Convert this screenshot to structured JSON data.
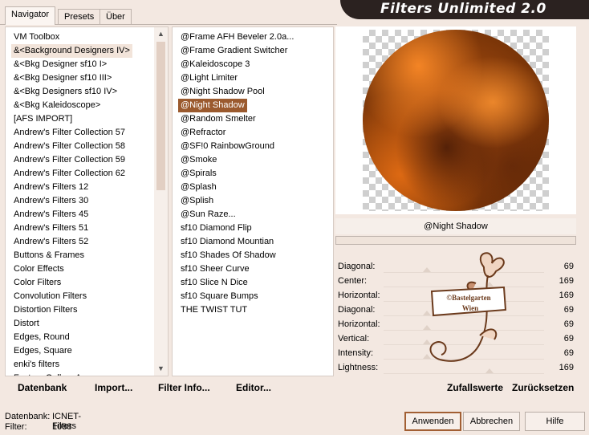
{
  "tabs": [
    {
      "label": "Navigator",
      "active": true
    },
    {
      "label": "Presets",
      "active": false
    },
    {
      "label": "Über",
      "active": false
    }
  ],
  "banner": {
    "title": "Filters Unlimited 2.0"
  },
  "categories": [
    "VM Toolbox",
    "&<Background Designers IV>",
    "&<Bkg Designer sf10 I>",
    "&<Bkg Designer sf10 III>",
    "&<Bkg Designers sf10 IV>",
    "&<Bkg Kaleidoscope>",
    "[AFS IMPORT]",
    "Andrew's Filter Collection 57",
    "Andrew's Filter Collection 58",
    "Andrew's Filter Collection 59",
    "Andrew's Filter Collection 62",
    "Andrew's Filters 12",
    "Andrew's Filters 30",
    "Andrew's Filters 45",
    "Andrew's Filters 51",
    "Andrew's Filters 52",
    "Buttons & Frames",
    "Color Effects",
    "Color Filters",
    "Convolution Filters",
    "Distortion Filters",
    "Distort",
    "Edges, Round",
    "Edges, Square",
    "enki's filters",
    "Factory Gallery A"
  ],
  "category_highlight_index": 1,
  "filters": [
    "@Frame AFH Beveler 2.0a...",
    "@Frame Gradient Switcher",
    "@Kaleidoscope 3",
    "@Light Limiter",
    "@Night Shadow Pool",
    "@Night Shadow",
    "@Random Smelter",
    "@Refractor",
    "@SF!0 RainbowGround",
    "@Smoke",
    "@Spirals",
    "@Splash",
    "@Splish",
    "@Sun Raze...",
    "sf10 Diamond Flip",
    "sf10 Diamond Mountian",
    "sf10 Shades Of Shadow",
    "sf10 Sheer Curve",
    "sf10 Slice N Dice",
    "sf10 Square Bumps",
    "THE TWIST TUT"
  ],
  "filter_selected_index": 5,
  "preview": {
    "label": "@Night Shadow"
  },
  "params": [
    {
      "name": "Diagonal:",
      "value": "69",
      "slider": 0.27
    },
    {
      "name": "Center:",
      "value": "169",
      "slider": 0.66
    },
    {
      "name": "Horizontal:",
      "value": "169",
      "slider": 0.66
    },
    {
      "name": "Diagonal:",
      "value": "69",
      "slider": 0.27
    },
    {
      "name": "Horizontal:",
      "value": "69",
      "slider": 0.27
    },
    {
      "name": "Vertical:",
      "value": "69",
      "slider": 0.27
    },
    {
      "name": "Intensity:",
      "value": "69",
      "slider": 0.27
    },
    {
      "name": "Lightness:",
      "value": "169",
      "slider": 0.66
    }
  ],
  "watermark": {
    "line1": "©Bastelgarten",
    "line2": "Wien"
  },
  "right_buttons": {
    "random": "Zufallswerte",
    "reset": "Zurücksetzen"
  },
  "left_buttons": {
    "database": "Datenbank",
    "import": "Import...",
    "filter_info": "Filter Info...",
    "editor": "Editor..."
  },
  "status": {
    "db_label": "Datenbank:",
    "db_value": "ICNET-Filters",
    "filter_label": "Filter:",
    "filter_value": "1088"
  },
  "dialog_buttons": {
    "apply": "Anwenden",
    "cancel": "Abbrechen",
    "help": "Hilfe"
  },
  "colors": {
    "accent": "#9b5a2e",
    "banner": "#2b2220",
    "background": "#f3e8e1"
  }
}
